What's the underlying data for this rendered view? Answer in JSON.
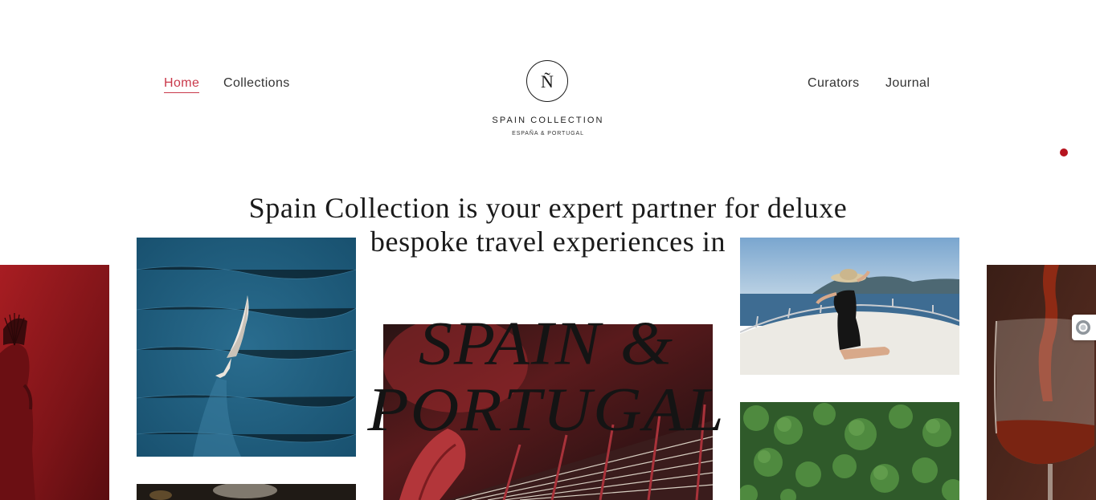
{
  "nav": {
    "home": "Home",
    "collections": "Collections",
    "curators": "Curators",
    "journal": "Journal"
  },
  "logo": {
    "monogram": "Ñ",
    "name": "SPAIN COLLECTION",
    "tagline": "ESPAÑA & PORTUGAL"
  },
  "hero": {
    "headline": "Spain Collection is your expert partner for deluxe bespoke travel experiences in",
    "destination_line1": "SPAIN &",
    "destination_line2": "PORTUGAL"
  },
  "colors": {
    "accent": "#c9384a",
    "indicator": "#b5141f"
  },
  "images": [
    "flamenco-dancer-with-fan",
    "sailboat-on-sea",
    "guitar-strings",
    "woman-on-boat-deck",
    "green-forest",
    "red-wine-pour"
  ]
}
